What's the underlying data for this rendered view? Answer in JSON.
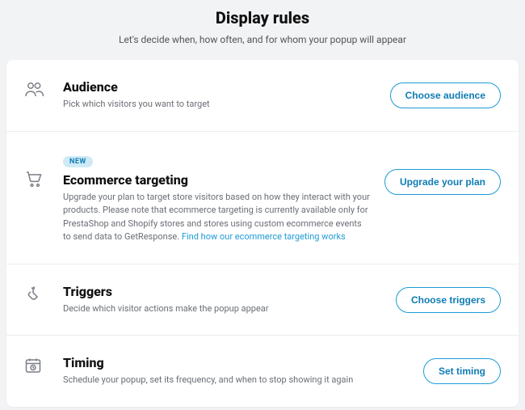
{
  "header": {
    "title": "Display rules",
    "subtitle": "Let's decide when, how often, and for whom your popup will appear"
  },
  "sections": {
    "audience": {
      "title": "Audience",
      "desc": "Pick which visitors you want to target",
      "button": "Choose audience"
    },
    "ecommerce": {
      "badge": "NEW",
      "title": "Ecommerce targeting",
      "desc": "Upgrade your plan to target store visitors based on how they interact with your products. Please note that ecommerce targeting is currently available only for PrestaShop and Shopify stores and stores using custom ecommerce events to send data to GetResponse. ",
      "link": "Find how our ecommerce targeting works",
      "button": "Upgrade your plan"
    },
    "triggers": {
      "title": "Triggers",
      "desc": "Decide which visitor actions make the popup appear",
      "button": "Choose triggers"
    },
    "timing": {
      "title": "Timing",
      "desc": "Schedule your popup, set its frequency, and when to stop showing it again",
      "button": "Set timing"
    }
  }
}
